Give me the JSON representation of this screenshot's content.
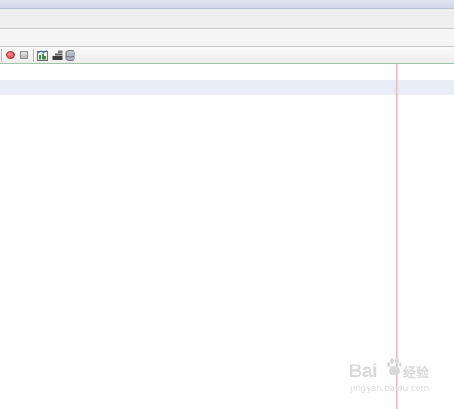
{
  "toolbar": {
    "buttons": [
      {
        "icon": "record-icon"
      },
      {
        "icon": "stop-icon"
      },
      {
        "icon": "chart-icon"
      },
      {
        "icon": "level-icon"
      },
      {
        "icon": "database-icon"
      }
    ]
  },
  "watermark": {
    "logo_text": "Bai",
    "logo_cn": "经验",
    "sub": "jingyan.baidu.com"
  },
  "colors": {
    "record": "#d93a3a",
    "selected_row": "#e8edf7",
    "divider": "#e8b7b7",
    "toolbar_border": "#9fc4a8"
  }
}
